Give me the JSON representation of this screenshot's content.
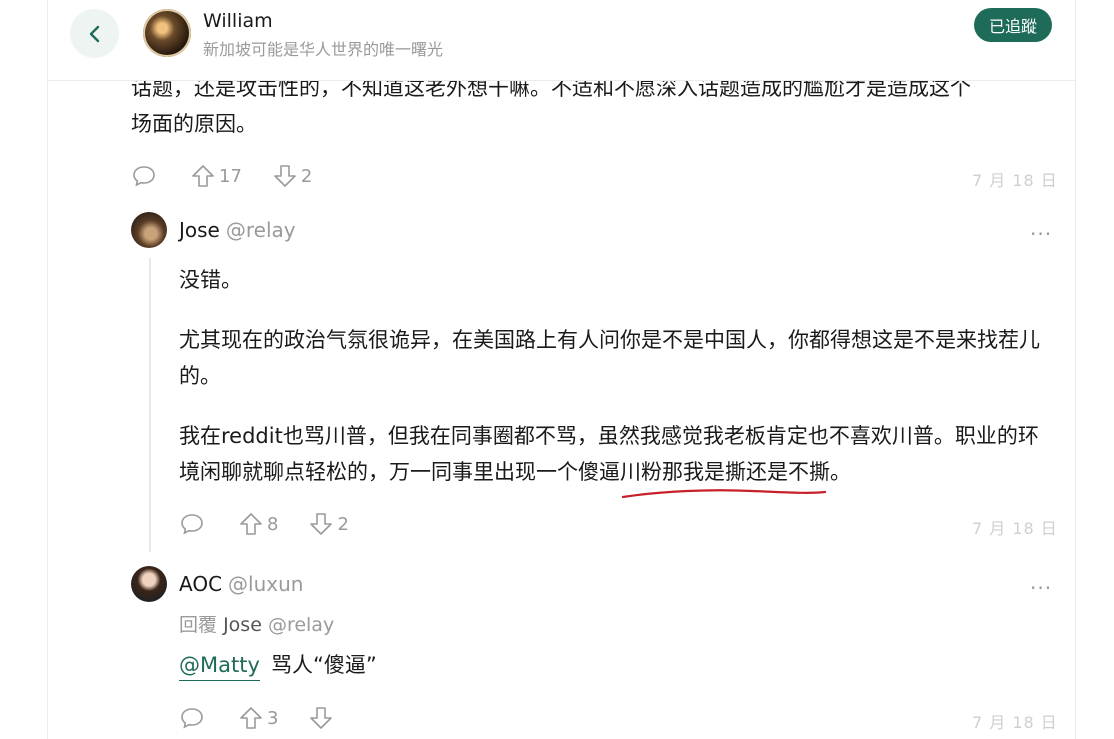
{
  "header": {
    "name": "William",
    "bio": "新加坡可能是华人世界的唯一曙光",
    "follow_label": "已追蹤"
  },
  "post": {
    "text_line1": "话题，还是攻击性的，不知道这老外想干嘛。不适和不愿深入话题造成的尴尬才是造成这个",
    "text_line2": "场面的原因。",
    "upvotes": "17",
    "downvotes": "2",
    "date": "7 月 18 日"
  },
  "comments": [
    {
      "name": "Jose",
      "handle": "@relay",
      "more": "···",
      "paragraphs": [
        "没错。",
        "尤其现在的政治气氛很诡异，在美国路上有人问你是不是中国人，你都得想这是不是来找茬儿的。",
        "我在reddit也骂川普，但我在同事圈都不骂，虽然我感觉我老板肯定也不喜欢川普。职业的环境闲聊就聊点轻松的，万一同事里出现一个傻逼川粉那我是撕还是不撕。"
      ],
      "upvotes": "8",
      "downvotes": "2",
      "date": "7 月 18 日"
    },
    {
      "name": "AOC",
      "handle": "@luxun",
      "more": "···",
      "reply_prefix": "回覆",
      "reply_name": "Jose",
      "reply_handle": "@relay",
      "mention": "@Matty",
      "text": "骂人“傻逼”",
      "upvotes": "3",
      "date": "7 月 18 日"
    }
  ],
  "colors": {
    "accent": "#1f6b5a",
    "muted": "#9a9a9a",
    "underline_annotation": "#c8202a"
  },
  "icons": [
    "back-icon",
    "comment-icon",
    "upvote-icon",
    "downvote-icon",
    "more-icon"
  ]
}
